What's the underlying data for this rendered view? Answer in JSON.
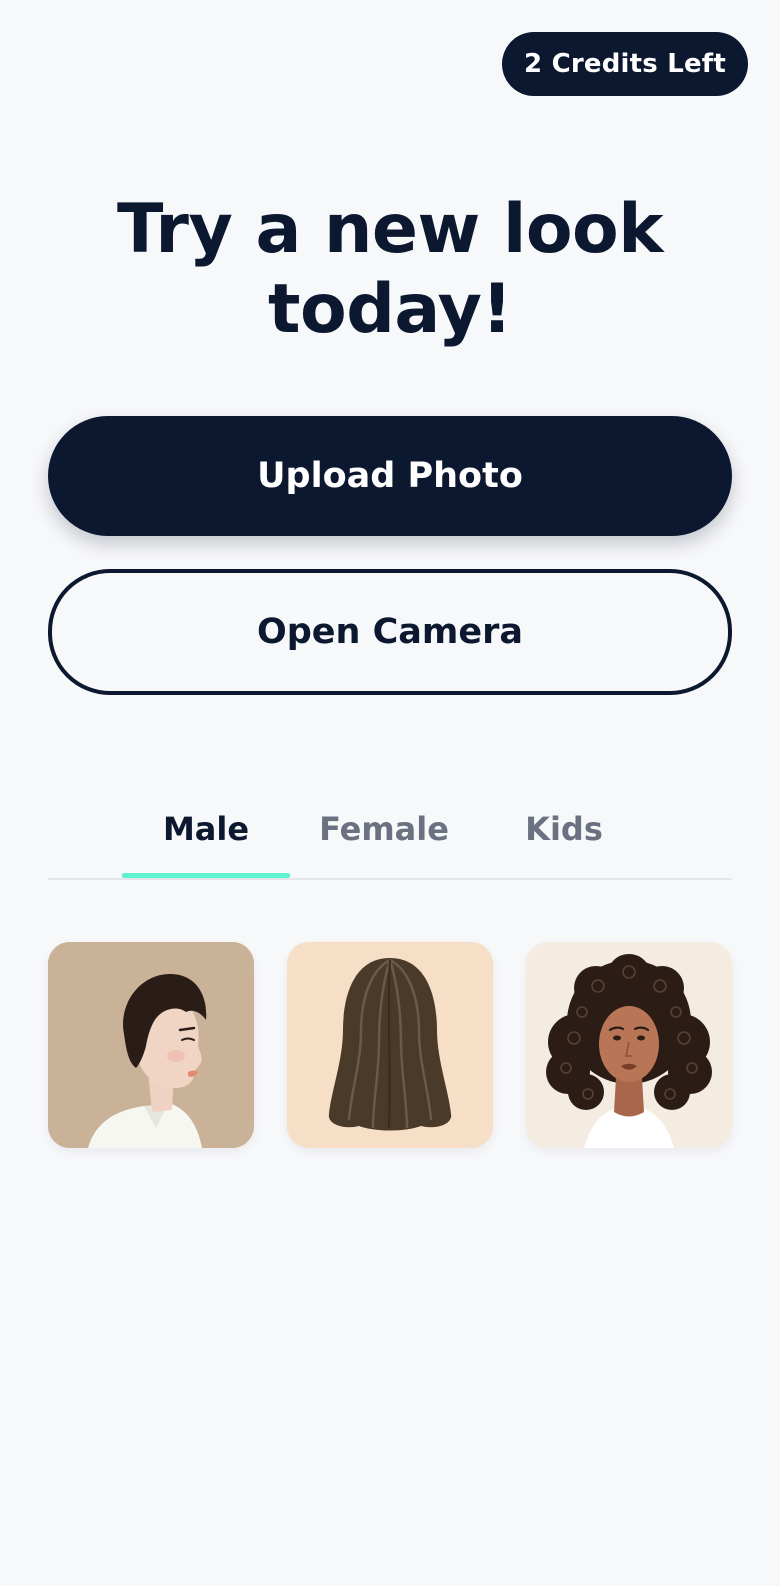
{
  "header": {
    "credits_label": "2 Credits Left"
  },
  "hero": {
    "title": "Try a new look today!"
  },
  "actions": {
    "upload_label": "Upload Photo",
    "camera_label": "Open Camera"
  },
  "tabs": [
    {
      "label": "Male",
      "active": true
    },
    {
      "label": "Female",
      "active": false
    },
    {
      "label": "Kids",
      "active": false
    }
  ],
  "styles": [
    {
      "icon": "short-hair-portrait-icon",
      "background": "#cab299"
    },
    {
      "icon": "long-straight-hair-icon",
      "background": "#f6dfc6"
    },
    {
      "icon": "curly-hair-portrait-icon",
      "background": "#f4ece0"
    }
  ],
  "colors": {
    "primary": "#0c1830",
    "accent": "#5ef2d1",
    "background": "#f7f8fa",
    "muted_text": "#6b7180"
  }
}
